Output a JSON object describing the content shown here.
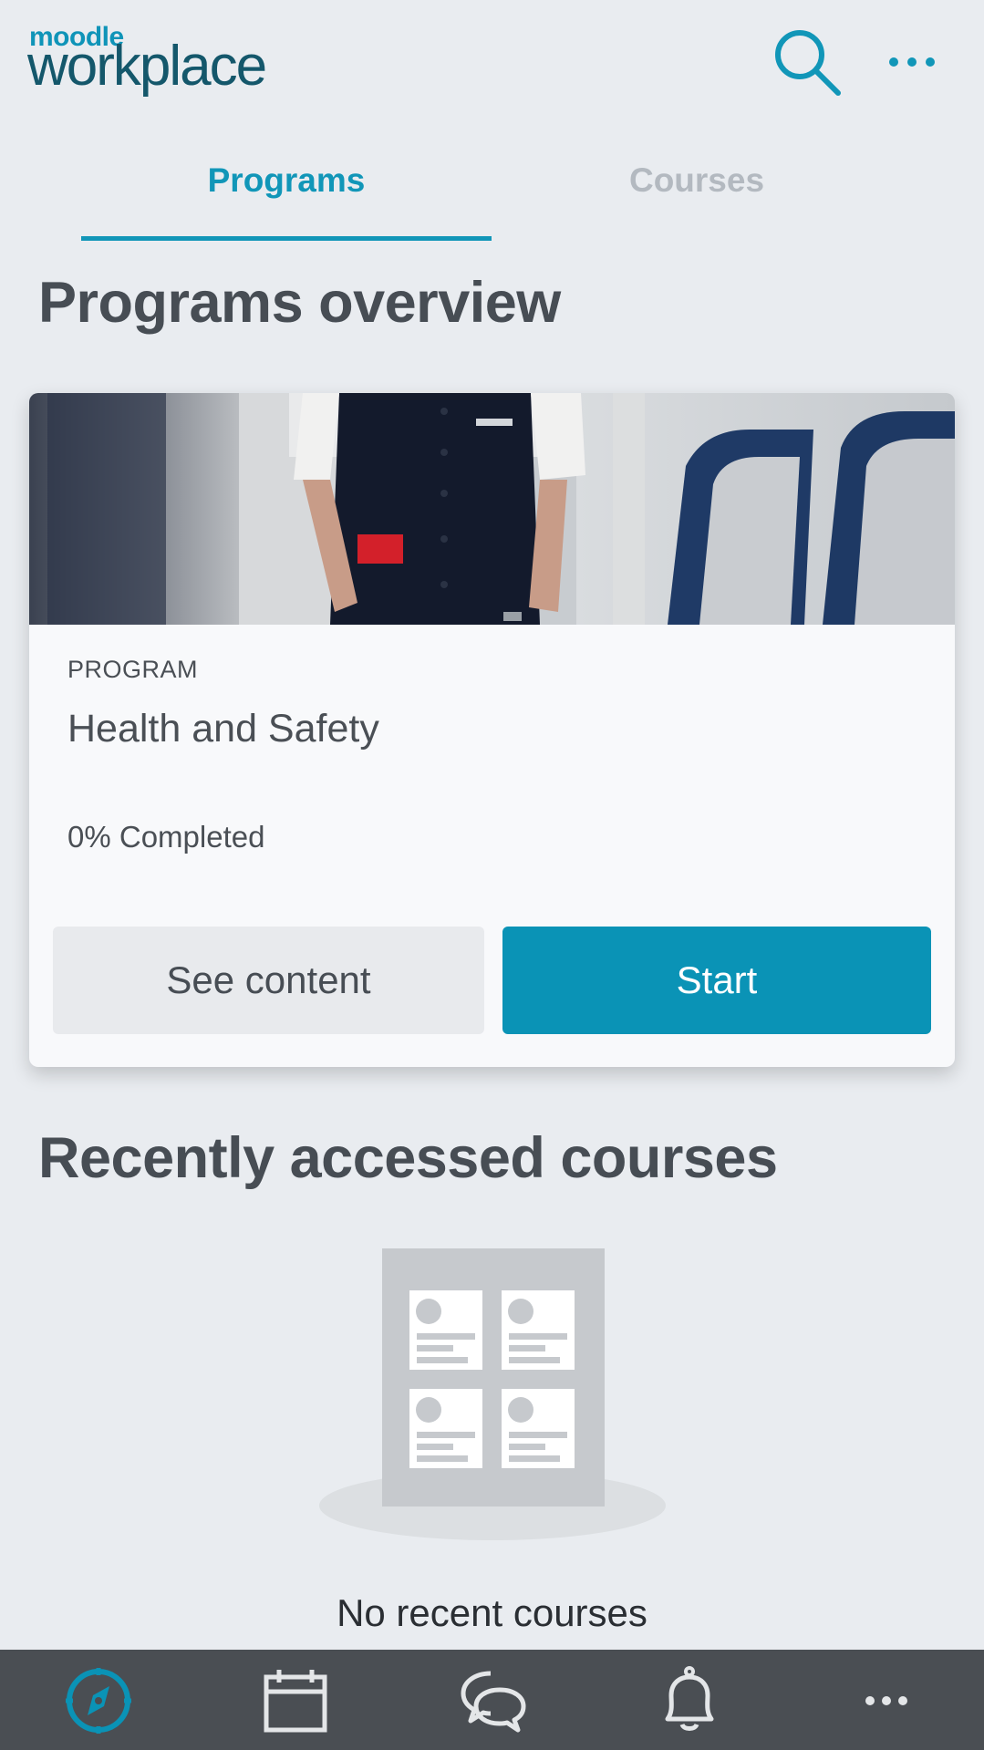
{
  "header": {
    "logo_small": "moodle",
    "logo_large": "workplace",
    "search_icon": "search-icon",
    "more_icon": "more-horizontal-icon"
  },
  "tabs": [
    {
      "label": "Programs",
      "active": true
    },
    {
      "label": "Courses",
      "active": false
    }
  ],
  "programs_section": {
    "title": "Programs overview",
    "card": {
      "label": "PROGRAM",
      "title": "Health and Safety",
      "progress_text": "0% Completed",
      "progress_percent": 0,
      "see_content_label": "See content",
      "start_label": "Start"
    }
  },
  "recent_section": {
    "title": "Recently accessed courses",
    "empty_text": "No recent courses"
  },
  "bottom_nav": [
    {
      "icon": "compass-icon",
      "active": true
    },
    {
      "icon": "calendar-icon",
      "active": false
    },
    {
      "icon": "chat-bubbles-icon",
      "active": false
    },
    {
      "icon": "bell-icon",
      "active": false
    },
    {
      "icon": "more-horizontal-icon",
      "active": false
    }
  ],
  "colors": {
    "accent": "#0a93b6",
    "background": "#e9ecf0",
    "nav_background": "#4a4e53",
    "logo_dark": "#14576b"
  }
}
